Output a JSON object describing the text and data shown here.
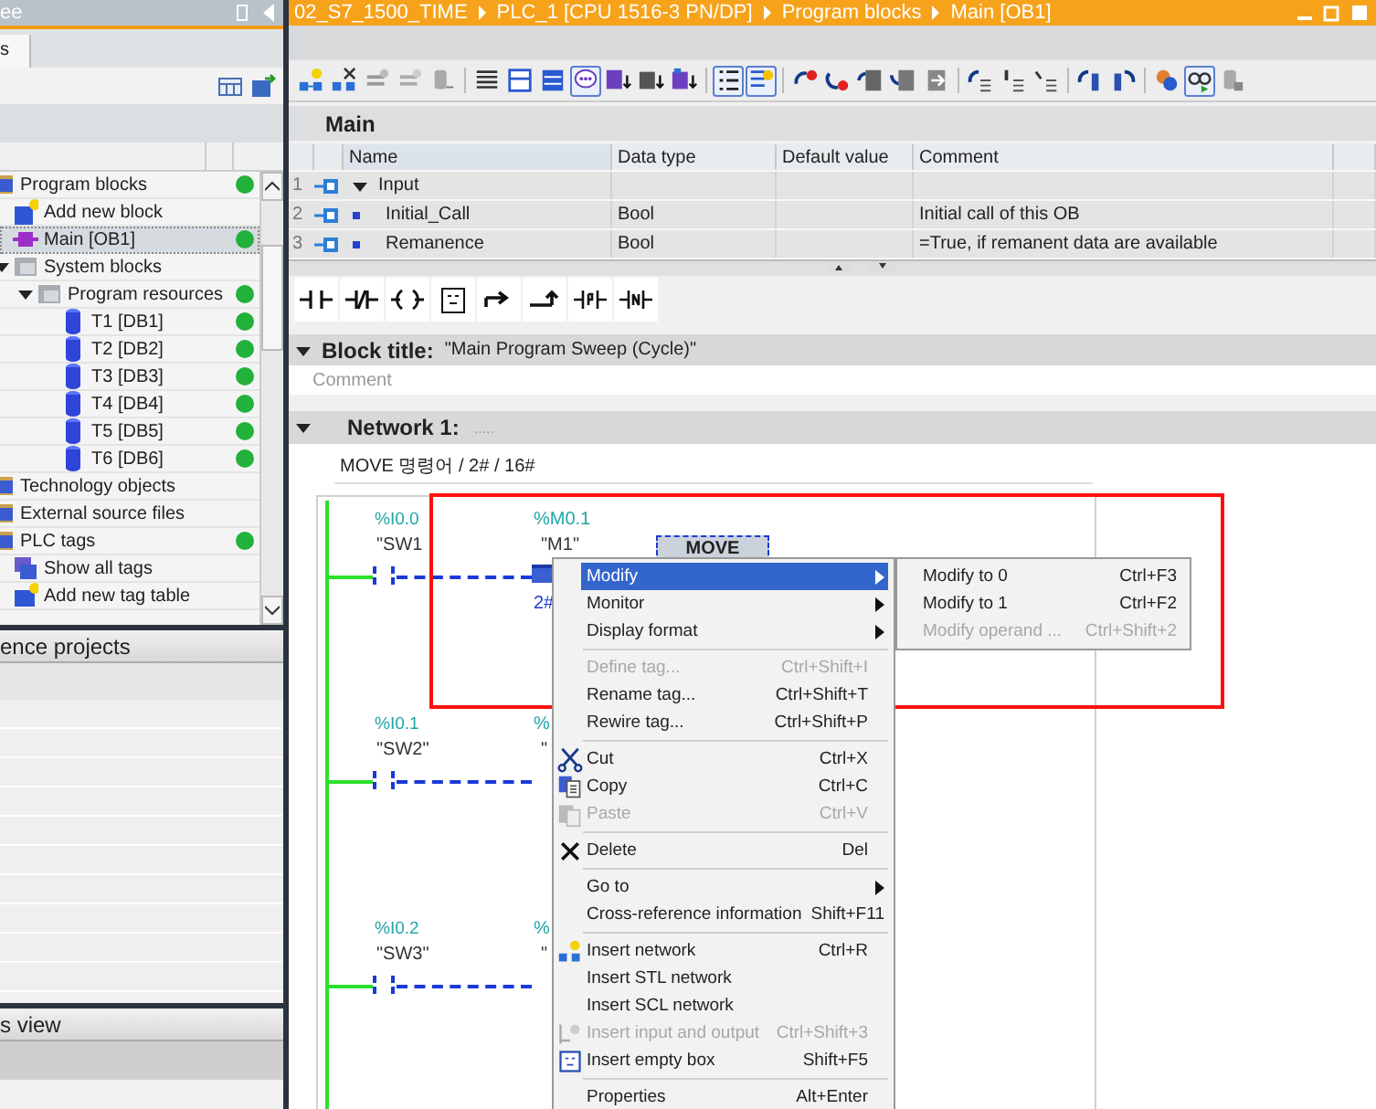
{
  "project_tree": {
    "title": "ee",
    "tab": "s",
    "items": [
      {
        "label": "Program blocks",
        "kind": "folder",
        "ok": true,
        "selected": false,
        "children": [
          {
            "label": "Add new block",
            "kind": "add_block",
            "ok": false,
            "selected": false
          },
          {
            "label": "Main [OB1]",
            "kind": "ob",
            "ok": true,
            "selected": true
          },
          {
            "label": "System blocks",
            "kind": "system_folder",
            "ok": false,
            "selected": false,
            "expanded": true,
            "children": [
              {
                "label": "Program resources",
                "kind": "system_folder",
                "ok": true,
                "selected": false,
                "expanded": true,
                "children": [
                  {
                    "label": "T1 [DB1]",
                    "kind": "db",
                    "ok": true,
                    "selected": false
                  },
                  {
                    "label": "T2 [DB2]",
                    "kind": "db",
                    "ok": true,
                    "selected": false
                  },
                  {
                    "label": "T3 [DB3]",
                    "kind": "db",
                    "ok": true,
                    "selected": false
                  },
                  {
                    "label": "T4 [DB4]",
                    "kind": "db",
                    "ok": true,
                    "selected": false
                  },
                  {
                    "label": "T5 [DB5]",
                    "kind": "db",
                    "ok": true,
                    "selected": false
                  },
                  {
                    "label": "T6 [DB6]",
                    "kind": "db",
                    "ok": true,
                    "selected": false
                  }
                ]
              }
            ]
          }
        ]
      },
      {
        "label": "Technology objects",
        "kind": "folder",
        "ok": false,
        "selected": false
      },
      {
        "label": "External source files",
        "kind": "folder",
        "ok": false,
        "selected": false
      },
      {
        "label": "PLC tags",
        "kind": "folder",
        "ok": true,
        "selected": false,
        "children": [
          {
            "label": "Show all tags",
            "kind": "show_tags",
            "ok": false,
            "selected": false
          },
          {
            "label": "Add new tag table",
            "kind": "add_table",
            "ok": false,
            "selected": false
          }
        ]
      }
    ]
  },
  "reference_projects": {
    "title": "ence projects"
  },
  "details_view": {
    "title": "s view"
  },
  "breadcrumb": [
    "02_S7_1500_TIME",
    "PLC_1 [CPU 1516-3 PN/DP]",
    "Program blocks",
    "Main [OB1]"
  ],
  "toolbar": [
    {
      "selected": false
    },
    {
      "selected": false
    },
    {
      "selected": false
    },
    {
      "selected": false
    },
    {
      "selected": false
    },
    {
      "selected": false
    },
    {
      "selected": false
    },
    {
      "selected": false
    },
    {
      "selected": true
    },
    {
      "selected": false
    },
    {
      "selected": false
    },
    {
      "selected": false
    },
    {
      "selected": true
    },
    {
      "selected": true
    },
    {
      "selected": false
    },
    {
      "selected": false
    },
    {
      "selected": false
    },
    {
      "selected": false
    },
    {
      "selected": false
    },
    {
      "selected": false
    },
    {
      "selected": false
    },
    {
      "selected": false
    },
    {
      "selected": false
    },
    {
      "selected": false
    },
    {
      "selected": false
    },
    {
      "selected": true
    },
    {
      "selected": false
    }
  ],
  "interface": {
    "title": "Main",
    "columns": [
      "Name",
      "Data type",
      "Default value",
      "Comment"
    ],
    "rows": [
      {
        "number": "1",
        "kind": "section",
        "name": "Input",
        "expanded": true
      },
      {
        "number": "2",
        "kind": "param",
        "name": "Initial_Call",
        "data_type": "Bool",
        "comment": "Initial call of this OB"
      },
      {
        "number": "3",
        "kind": "param",
        "name": "Remanence",
        "data_type": "Bool",
        "comment": "=True, if remanent data are available"
      }
    ]
  },
  "block": {
    "label": "Block title:",
    "title": "\"Main Program Sweep (Cycle)\"",
    "comment_placeholder": "Comment",
    "expanded": true
  },
  "network": {
    "label": "Network 1:",
    "title_placeholder": ".....",
    "expanded": true,
    "comment": "MOVE 명령어 / 2# / 16#",
    "rungs": [
      {
        "contact_address": "%I0.0",
        "contact_tag": "\"SW1",
        "operand_address": "%M0.1",
        "operand_tag": "\"M1\"",
        "box": "MOVE",
        "input": "2#"
      },
      {
        "contact_address": "%I0.1",
        "contact_tag": "\"SW2\"",
        "operand_address": "%",
        "operand_tag": "\""
      },
      {
        "contact_address": "%I0.2",
        "contact_tag": "\"SW3\"",
        "operand_address": "%",
        "operand_tag": "\""
      }
    ]
  },
  "context_menu": {
    "items": [
      {
        "kind": "item",
        "label": "Modify",
        "submenu": true,
        "selected": true,
        "disabled": false
      },
      {
        "kind": "item",
        "label": "Monitor",
        "submenu": true,
        "selected": false,
        "disabled": false
      },
      {
        "kind": "item",
        "label": "Display format",
        "submenu": true,
        "selected": false,
        "disabled": false
      },
      {
        "kind": "separator"
      },
      {
        "kind": "item",
        "label": "Define tag...",
        "shortcut": "Ctrl+Shift+I",
        "selected": false,
        "disabled": true
      },
      {
        "kind": "item",
        "label": "Rename tag...",
        "shortcut": "Ctrl+Shift+T",
        "selected": false,
        "disabled": false
      },
      {
        "kind": "item",
        "label": "Rewire tag...",
        "shortcut": "Ctrl+Shift+P",
        "selected": false,
        "disabled": false
      },
      {
        "kind": "separator"
      },
      {
        "kind": "item",
        "label": "Cut",
        "shortcut": "Ctrl+X",
        "selected": false,
        "disabled": false
      },
      {
        "kind": "item",
        "label": "Copy",
        "shortcut": "Ctrl+C",
        "selected": false,
        "disabled": false
      },
      {
        "kind": "item",
        "label": "Paste",
        "shortcut": "Ctrl+V",
        "selected": false,
        "disabled": true
      },
      {
        "kind": "separator"
      },
      {
        "kind": "item",
        "label": "Delete",
        "shortcut": "Del",
        "selected": false,
        "disabled": false
      },
      {
        "kind": "separator"
      },
      {
        "kind": "item",
        "label": "Go to",
        "submenu": true,
        "selected": false,
        "disabled": false
      },
      {
        "kind": "item",
        "label": "Cross-reference information",
        "shortcut": "Shift+F11",
        "selected": false,
        "disabled": false
      },
      {
        "kind": "separator"
      },
      {
        "kind": "item",
        "label": "Insert network",
        "shortcut": "Ctrl+R",
        "selected": false,
        "disabled": false
      },
      {
        "kind": "item",
        "label": "Insert STL network",
        "selected": false,
        "disabled": false
      },
      {
        "kind": "item",
        "label": "Insert SCL network",
        "selected": false,
        "disabled": false
      },
      {
        "kind": "item",
        "label": "Insert input and output",
        "shortcut": "Ctrl+Shift+3",
        "selected": false,
        "disabled": true
      },
      {
        "kind": "item",
        "label": "Insert empty box",
        "shortcut": "Shift+F5",
        "selected": false,
        "disabled": false
      },
      {
        "kind": "separator"
      },
      {
        "kind": "item",
        "label": "Properties",
        "shortcut": "Alt+Enter",
        "selected": false,
        "disabled": false
      }
    ]
  },
  "submenu": {
    "items": [
      {
        "label": "Modify to 0",
        "shortcut": "Ctrl+F3",
        "disabled": false
      },
      {
        "label": "Modify to 1",
        "shortcut": "Ctrl+F2",
        "disabled": false
      },
      {
        "label": "Modify operand ...",
        "shortcut": "Ctrl+Shift+2",
        "disabled": true
      }
    ]
  }
}
